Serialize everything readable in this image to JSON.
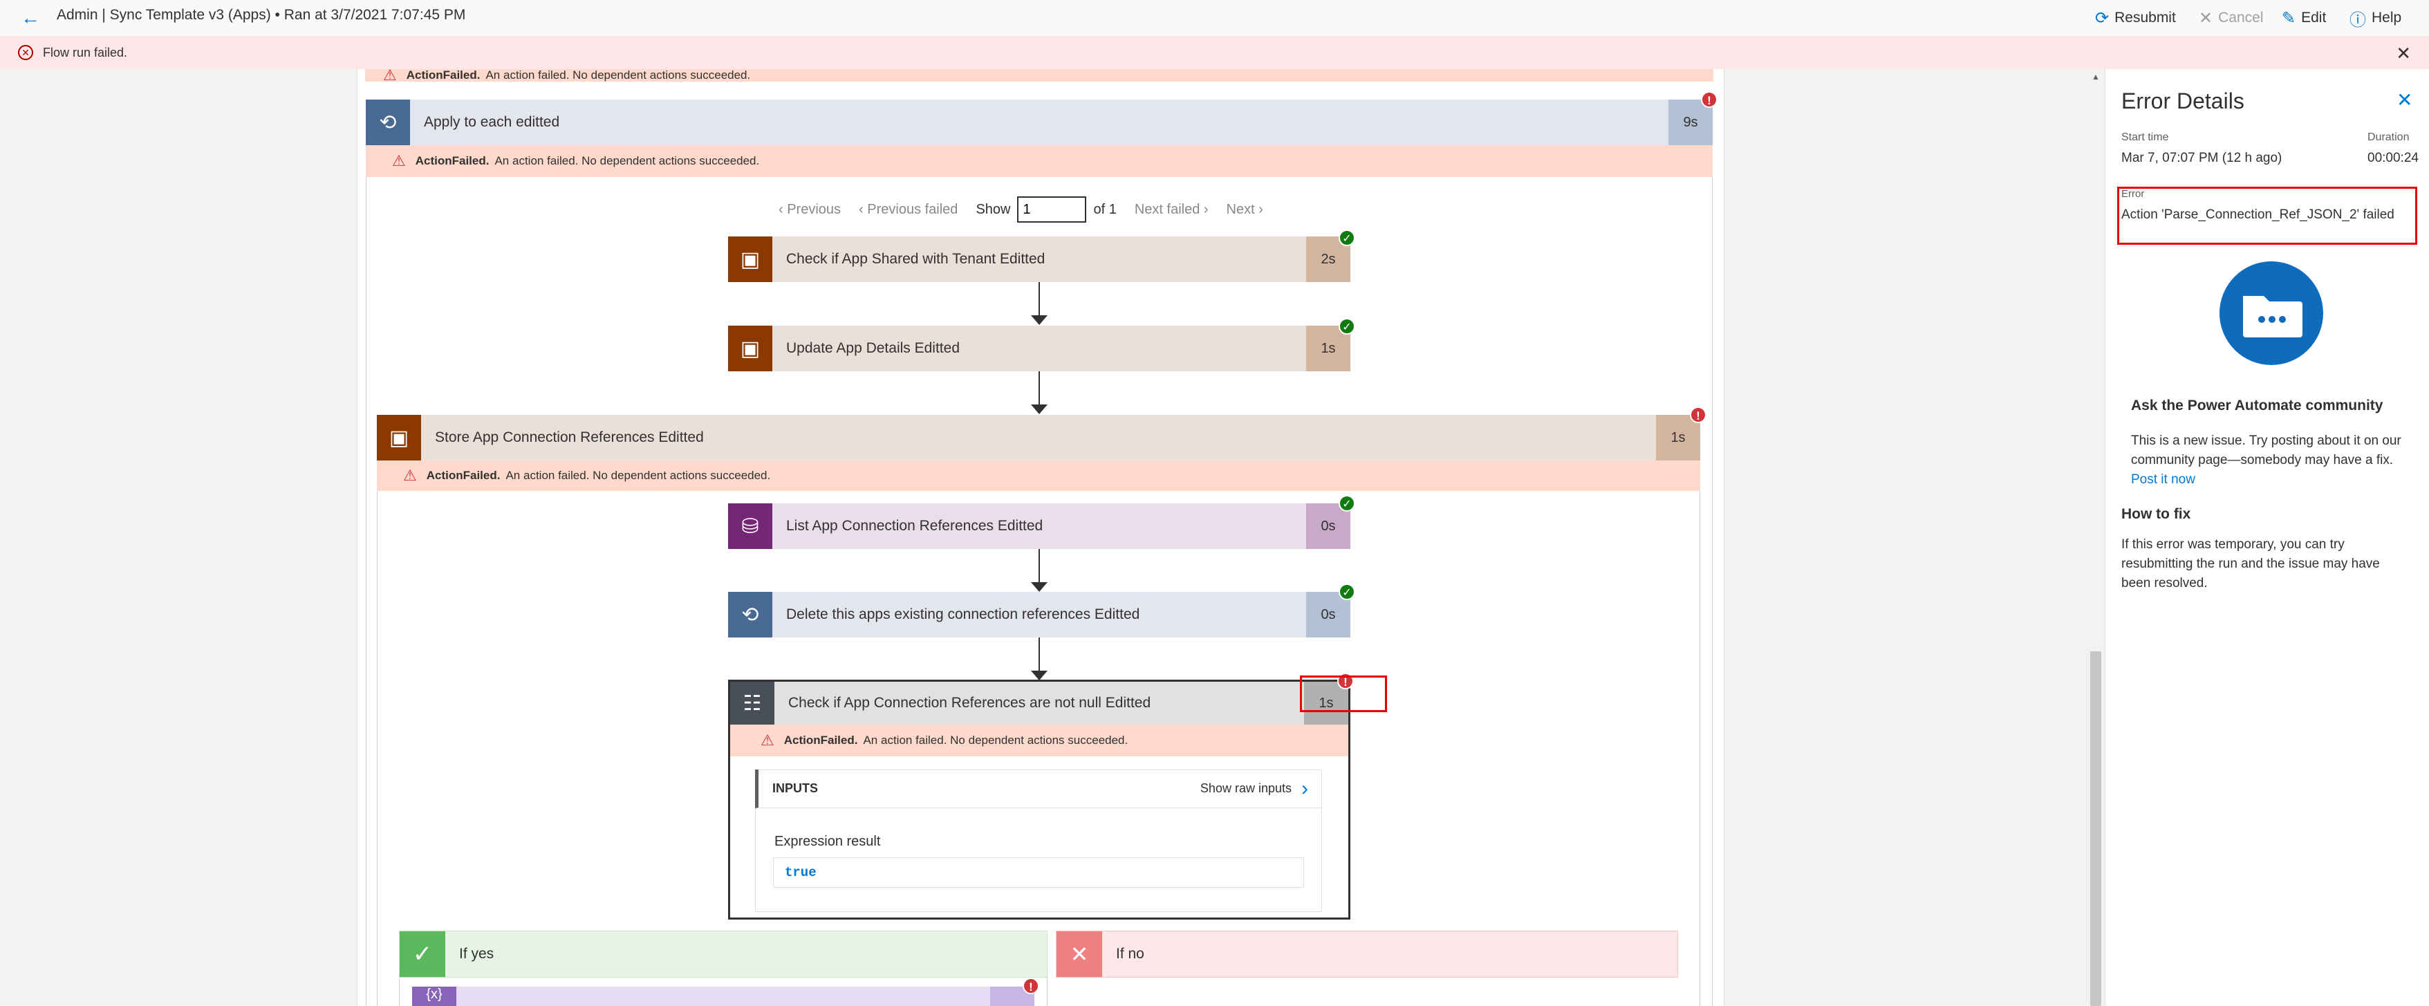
{
  "header": {
    "back_icon": "arrow-left-icon",
    "title": "Admin | Sync Template v3 (Apps) • Ran at 3/7/2021 7:07:45 PM",
    "resubmit": "Resubmit",
    "cancel": "Cancel",
    "edit": "Edit",
    "help": "Help"
  },
  "error_bar": {
    "message": "Flow run failed."
  },
  "canvas": {
    "top_failed": {
      "code": "ActionFailed.",
      "text": "An action failed. No dependent actions succeeded."
    },
    "apply_each": {
      "label": "Apply to each editted",
      "duration": "9s",
      "failed_code": "ActionFailed.",
      "failed_text": "An action failed. No dependent actions succeeded."
    },
    "pager": {
      "previous": "Previous",
      "previous_failed": "Previous failed",
      "show": "Show",
      "value": "1",
      "of": "of 1",
      "next_failed": "Next failed",
      "next": "Next"
    },
    "actions": [
      {
        "label": "Check if App Shared with Tenant Editted",
        "duration": "2s"
      },
      {
        "label": "Update App Details Editted",
        "duration": "1s"
      }
    ],
    "store_scope": {
      "label": "Store App Connection References Editted",
      "duration": "1s",
      "failed_code": "ActionFailed.",
      "failed_text": "An action failed. No dependent actions succeeded."
    },
    "inner_actions": [
      {
        "label": "List App Connection References Editted",
        "duration": "0s"
      },
      {
        "label": "Delete this apps existing connection references Editted",
        "duration": "0s"
      }
    ],
    "condition": {
      "label": "Check if App Connection References are not null Editted",
      "duration": "1s",
      "failed_code": "ActionFailed.",
      "failed_text": "An action failed. No dependent actions succeeded.",
      "inputs_title": "INPUTS",
      "show_raw": "Show raw inputs",
      "expr_label": "Expression result",
      "expr_value": "true"
    },
    "branches": {
      "yes": "If yes",
      "no": "If no"
    }
  },
  "error_details": {
    "title": "Error Details",
    "start_label": "Start time",
    "start_value": "Mar 7, 07:07 PM (12 h ago)",
    "duration_label": "Duration",
    "duration_value": "00:00:24",
    "error_label": "Error",
    "error_value": "Action 'Parse_Connection_Ref_JSON_2' failed",
    "community_title": "Ask the Power Automate community",
    "community_text": "This is a new issue. Try posting about it on our community page—somebody may have a fix.",
    "post_link": "Post it now",
    "howto_title": "How to fix",
    "howto_text": "If this error was temporary, you can try resubmitting the run and the issue may have been resolved."
  },
  "colors": {
    "accent": "#0078d4",
    "failed_bg": "#fed9cc",
    "error_red": "#d13438",
    "success_green": "#107c10",
    "loop_blue": "#486991",
    "control_brown": "#8c3900",
    "dataverse_purple": "#742774",
    "condition_gray": "#484f58"
  }
}
